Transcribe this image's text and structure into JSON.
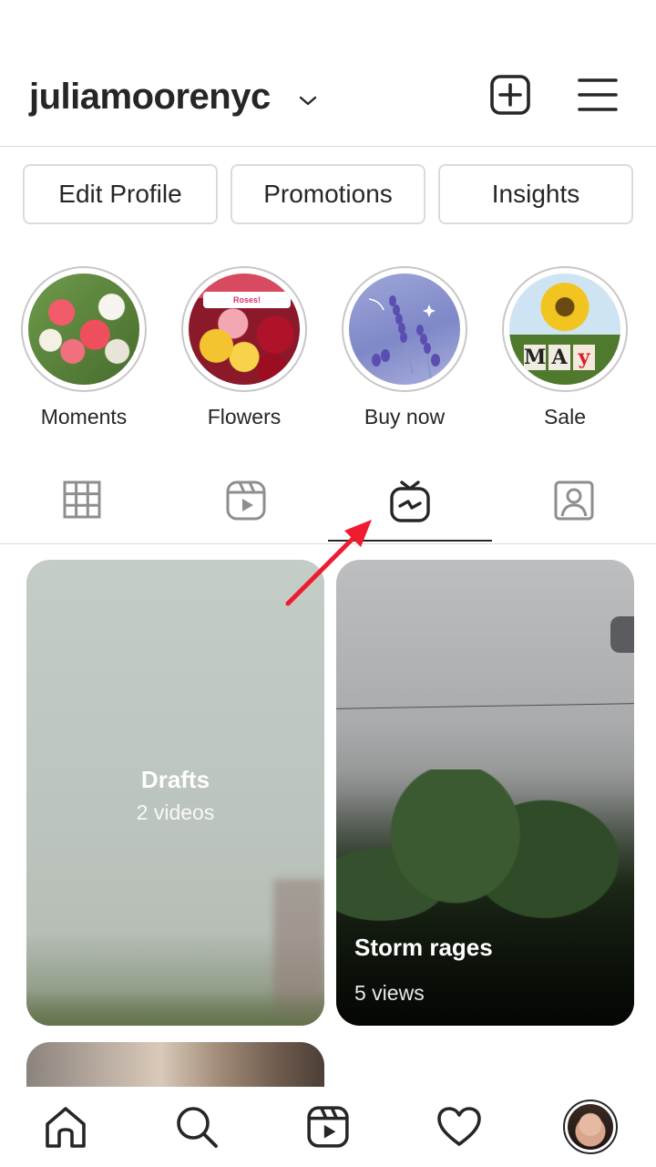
{
  "header": {
    "username": "juliamoorenyc",
    "icons": {
      "chevron": "chevron-down-icon",
      "new_post": "plus-square-icon",
      "menu": "hamburger-menu-icon"
    }
  },
  "profile_actions": {
    "edit_profile": "Edit Profile",
    "promotions": "Promotions",
    "insights": "Insights"
  },
  "highlights": [
    {
      "label": "Moments"
    },
    {
      "label": "Flowers",
      "overlay_text": "Roses!"
    },
    {
      "label": "Buy now"
    },
    {
      "label": "Sale",
      "overlay_text": "MAY"
    }
  ],
  "tabs": [
    {
      "icon": "grid-icon",
      "active": false
    },
    {
      "icon": "reels-icon",
      "active": false
    },
    {
      "icon": "igtv-icon",
      "active": true
    },
    {
      "icon": "tagged-icon",
      "active": false
    }
  ],
  "videos": [
    {
      "title": "Drafts",
      "subtitle": "2 videos"
    },
    {
      "title": "Storm rages",
      "subtitle": "5 views"
    }
  ],
  "bottom_nav": [
    {
      "icon": "home-icon"
    },
    {
      "icon": "search-icon"
    },
    {
      "icon": "reels-icon"
    },
    {
      "icon": "heart-icon"
    },
    {
      "icon": "profile-avatar"
    }
  ],
  "annotation": {
    "color": "#ee1c2e",
    "icon": "red-arrow"
  }
}
